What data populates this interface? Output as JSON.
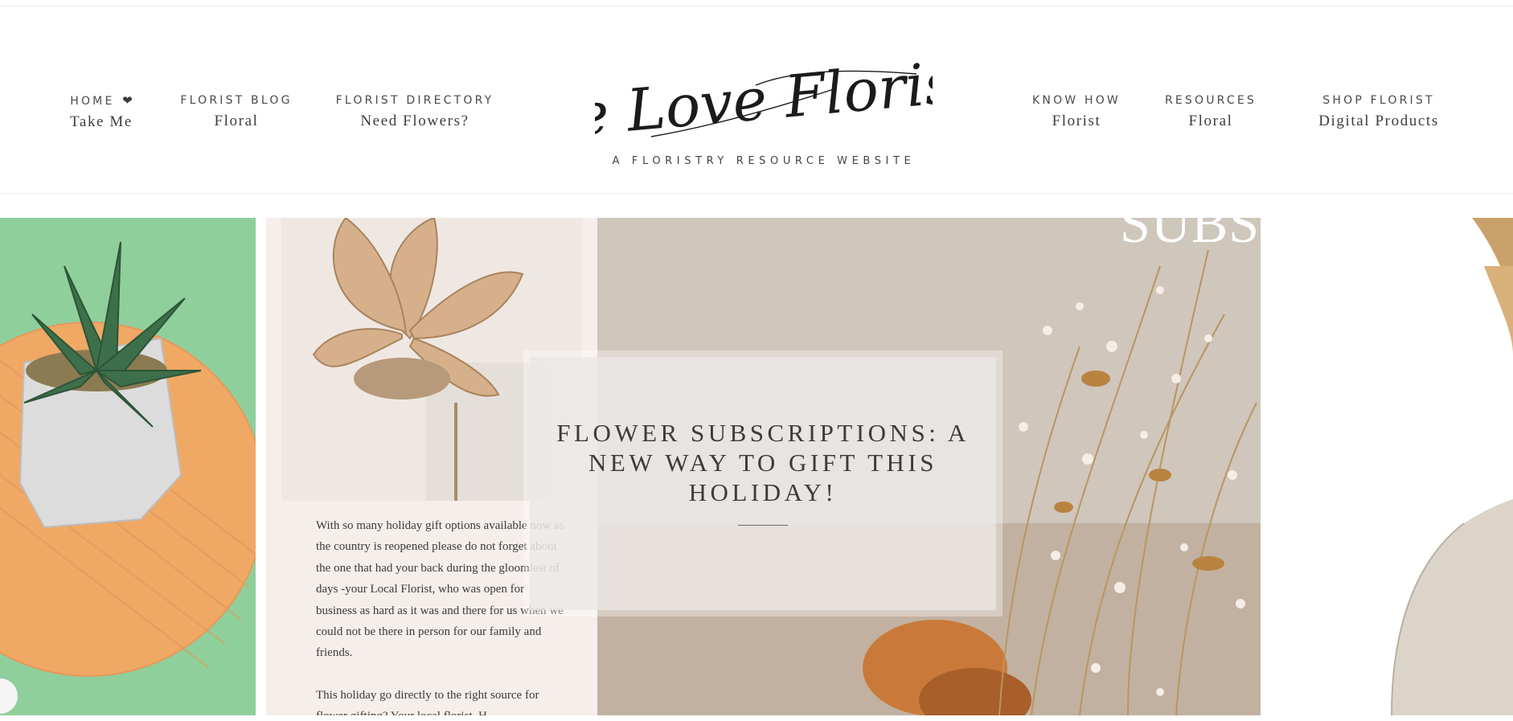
{
  "header": {
    "nav_left": [
      {
        "top": "HOME",
        "bottom": "Take Me",
        "icon": "heart-icon"
      },
      {
        "top": "FLORIST BLOG",
        "bottom": "Floral"
      },
      {
        "top": "FLORIST DIRECTORY",
        "bottom": "Need Flowers?"
      }
    ],
    "nav_right": [
      {
        "top": "KNOW HOW",
        "bottom": "Florist"
      },
      {
        "top": "RESOURCES",
        "bottom": "Floral"
      },
      {
        "top": "SHOP FLORIST",
        "bottom": "Digital Products"
      }
    ],
    "logo": {
      "script": "We Love Florists",
      "tagline": "A FLORISTRY RESOURCE WEBSITE"
    }
  },
  "slider": {
    "featured": {
      "title": "FLOWER SUBSCRIPTIONS: A NEW WAY TO GIFT THIS HOLIDAY!",
      "image_heading": "SUBSCRIPTIONS",
      "excerpt_paragraphs": [
        "With so many holiday gift options available now as the country is reopened please do not forget about the one that had your back during the gloomiest of days -your Local Florist, who was open for business as hard as it was and there for us when we could not be there in person for our family and friends.",
        "This holiday go directly to the right source for flower gifting? Your local florist. H"
      ]
    }
  },
  "colors": {
    "nav_text": "#4a4a4a",
    "succulent_bg": "#8fcf9c",
    "pot_plate": "#f0a865",
    "caption_bg": "#ece9e6"
  }
}
